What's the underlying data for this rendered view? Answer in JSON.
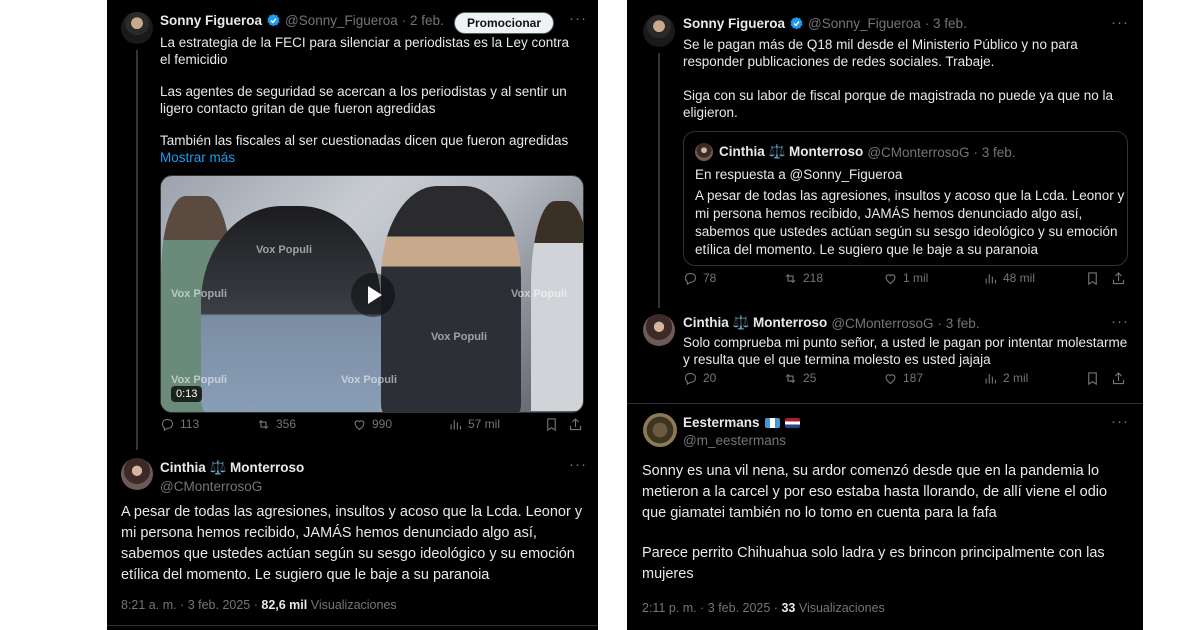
{
  "left": {
    "tweet1": {
      "name": "Sonny Figueroa",
      "handle": "@Sonny_Figueroa",
      "date": "· 2 feb.",
      "promote_label": "Promocionar",
      "more": "···",
      "para1": "La estrategia de la FECI para silenciar a periodistas es la Ley contra el femicidio",
      "para2": "Las agentes de seguridad se acercan a los periodistas y al sentir un ligero contacto gritan de que fueron agredidas",
      "para3": "También las fiscales al ser cuestionadas dicen que fueron agredidas",
      "show_more": "Mostrar más",
      "video": {
        "watermark": "Vox Populi",
        "duration": "0:13"
      },
      "stats": {
        "replies": "113",
        "reposts": "356",
        "likes": "990",
        "views": "57 mil"
      }
    },
    "tweet2": {
      "name": "Cinthia ⚖️ Monterroso",
      "handle": "@CMonterrosoG",
      "more": "···",
      "body_lines": [
        "A pesar de todas las agresiones, insultos y acoso que la Lcda. Leonor y",
        "mi persona hemos recibido, JAMÁS hemos denunciado algo así,",
        "sabemos que ustedes actúan según su sesgo ideológico y su emoción",
        "etílica del momento. Le sugiero que le baje a su paranoia"
      ],
      "time": "8:21 a. m. · 3 feb. 2025 ·",
      "views_count": "82,6 mil",
      "views_label": "Visualizaciones"
    }
  },
  "right": {
    "tweet1": {
      "name": "Sonny Figueroa",
      "handle": "@Sonny_Figueroa",
      "date": "· 3 feb.",
      "more": "···",
      "para1": "Se le pagan más de Q18 mil desde el Ministerio Público y no para responder publicaciones de redes sociales. Trabaje.",
      "para2": "Siga con su labor de fiscal porque de magistrada no puede ya que no la eligieron.",
      "quote": {
        "name": "Cinthia ⚖️ Monterroso",
        "handle": "@CMonterrosoG",
        "date": "· 3 feb.",
        "reply_to": "En respuesta a @Sonny_Figueroa",
        "body_lines": [
          "A pesar de todas las agresiones, insultos y acoso que la Lcda. Leonor y",
          "mi persona hemos recibido, JAMÁS hemos denunciado algo así,",
          "sabemos que ustedes actúan según su sesgo ideológico y su emoción",
          "etílica del momento. Le sugiero que le baje a su paranoia"
        ]
      },
      "stats": {
        "replies": "78",
        "reposts": "218",
        "likes": "1 mil",
        "views": "48 mil"
      }
    },
    "tweet2": {
      "name": "Cinthia ⚖️ Monterroso",
      "handle": "@CMonterrosoG",
      "date": "· 3 feb.",
      "more": "···",
      "body_lines": [
        "Solo comprueba mi punto señor, a usted le pagan por intentar molestarme",
        "y resulta que el que termina molesto es usted jajaja"
      ],
      "stats": {
        "replies": "20",
        "reposts": "25",
        "likes": "187",
        "views": "2 mil"
      }
    },
    "tweet3": {
      "name": "Eestermans",
      "handle": "@m_eestermans",
      "more": "···",
      "body_lines": [
        "Sonny es una vil nena, su ardor comenzó desde que en la pandemia lo",
        "metieron a la carcel y por eso estaba hasta llorando, de allí viene el odio",
        "que giamatei también no lo tomo en cuenta para la fafa"
      ],
      "body_lines2": [
        "Parece perrito Chihuahua solo ladra y es brincon principalmente con las",
        "mujeres"
      ],
      "time": "2:11 p. m. · 3 feb. 2025 ·",
      "views_count": "33",
      "views_label": "Visualizaciones"
    }
  },
  "colors": {
    "bg": "#000000",
    "text": "#e7e9ea",
    "muted": "#71767b",
    "link": "#1d9bf0",
    "verified": "#1d9bf0"
  }
}
